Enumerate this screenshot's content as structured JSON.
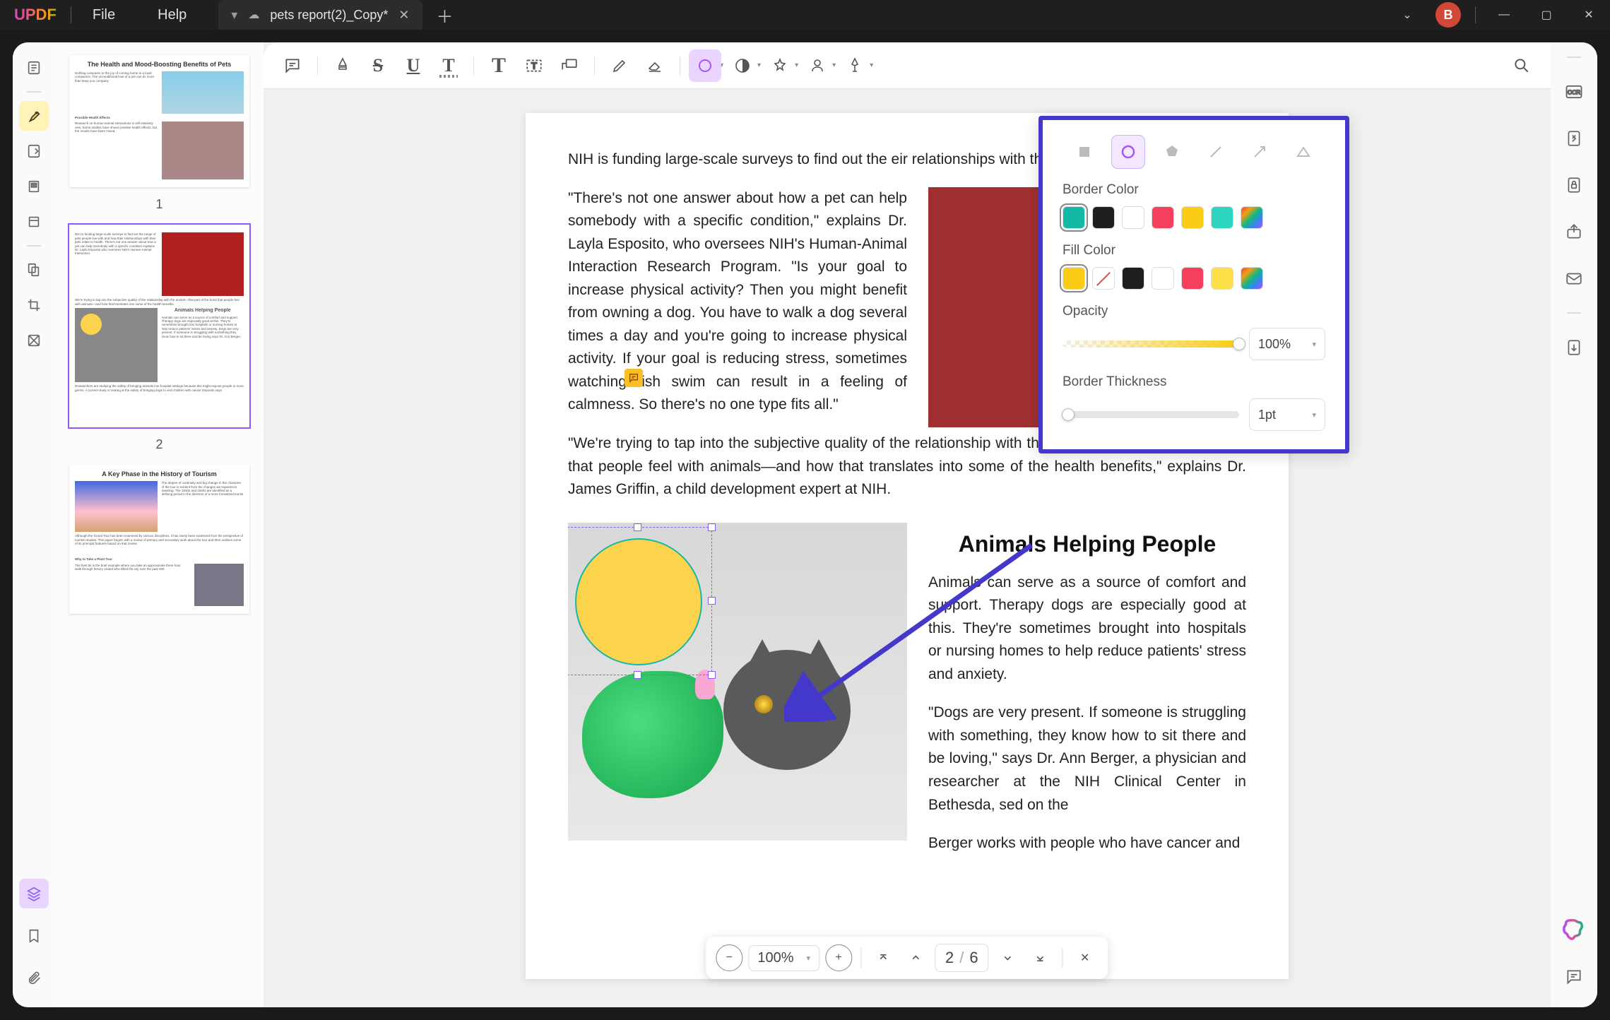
{
  "titlebar": {
    "logo": "UPDF",
    "menu": {
      "file": "File",
      "help": "Help"
    },
    "tab": {
      "title": "pets report(2)_Copy*"
    },
    "avatar": "B"
  },
  "thumbs": {
    "page1": {
      "num": "1",
      "title": "The Health and Mood-Boosting Benefits of Pets",
      "h1": "Possible Health Effects"
    },
    "page2": {
      "num": "2",
      "title": "Animals Helping People"
    },
    "page3": {
      "num": "3",
      "title": "A Key Phase in the History of Tourism",
      "h1": "Why to Take a Plant Tour"
    }
  },
  "doc": {
    "p1": "NIH is funding large-scale surveys to find out the                                   eir relationships with their pets relate to health.",
    "p2": "\"There's not one answer about how a pet can help somebody with a specific condition,\" explains Dr. Layla Esposito, who oversees NIH's Human-Animal Interaction Research Program. \"Is your goal to increase physical activity? Then you might benefit from owning a dog. You have to walk a dog several times a day and you're going to increase physical activity. If your goal is reducing stress, sometimes watching fish swim can result in a feeling of calmness. So there's no one type fits all.\"",
    "p3": "\"We're trying to tap into the subjective quality of the relationship with the animal—that part of the bond that people feel with animals—and how that translates into some of the health benefits,\" explains Dr. James Griffin, a child development expert at NIH.",
    "h2": "Animals Helping People",
    "p4": "Animals can serve as a source of comfort and support. Therapy dogs are especially good at this. They're sometimes brought into hospitals or nursing homes to help reduce patients' stress and anxiety.",
    "p5": "\"Dogs are very present. If someone is struggling with something, they know how to sit there and be loving,\" says Dr. Ann Berger, a physician and researcher at the NIH Clinical Center in Bethesda,                                                                                                      sed on the",
    "p6": "Berger works with people who have cancer and"
  },
  "panel": {
    "border_color": "Border Color",
    "fill_color": "Fill Color",
    "opacity": "Opacity",
    "opacity_val": "100%",
    "thickness": "Border Thickness",
    "thickness_val": "1pt",
    "border_colors": [
      "#14b8a6",
      "#1f1f1f",
      "#ffffff",
      "#f43f5e",
      "#facc15",
      "#2dd4bf",
      "rainbow"
    ],
    "fill_colors": [
      "#facc15",
      "none",
      "#1f1f1f",
      "#ffffff",
      "#f43f5e",
      "#fde047",
      "rainbow"
    ]
  },
  "bottombar": {
    "zoom": "100%",
    "page_current": "2",
    "page_sep": "/",
    "page_total": "6"
  }
}
